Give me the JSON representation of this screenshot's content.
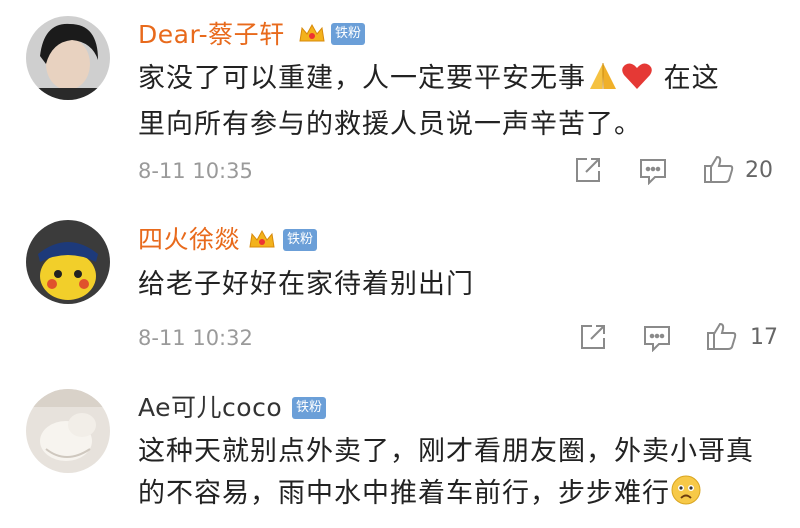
{
  "comments": [
    {
      "username": "Dear-蔡子轩",
      "badge": "铁粉",
      "text_line1": "家没了可以重建，人一定要平安无事",
      "text_line1_tail": "在这",
      "text_line2": "里向所有参与的救援人员说一声辛苦了。",
      "time": "8-11 10:35",
      "likes": "20"
    },
    {
      "username": "四火徐燚",
      "badge": "铁粉",
      "text_line1": "给老子好好在家待着别出门",
      "time": "8-11 10:32",
      "likes": "17"
    },
    {
      "username": "Ae可儿coco",
      "badge": "铁粉",
      "text_line1": "这种天就别点外卖了，刚才看朋友圈，外卖小哥真",
      "text_line2": "的不容易，雨中水中推着车前行，步步难行"
    }
  ],
  "colors": {
    "vip_name": "#e86a1c",
    "badge": "#6b9fd8",
    "meta": "#9a9a9a"
  },
  "icons": [
    "pray-emoji",
    "heart-emoji",
    "share-icon",
    "comment-icon",
    "like-icon",
    "sad-emoji",
    "crown-icon"
  ]
}
